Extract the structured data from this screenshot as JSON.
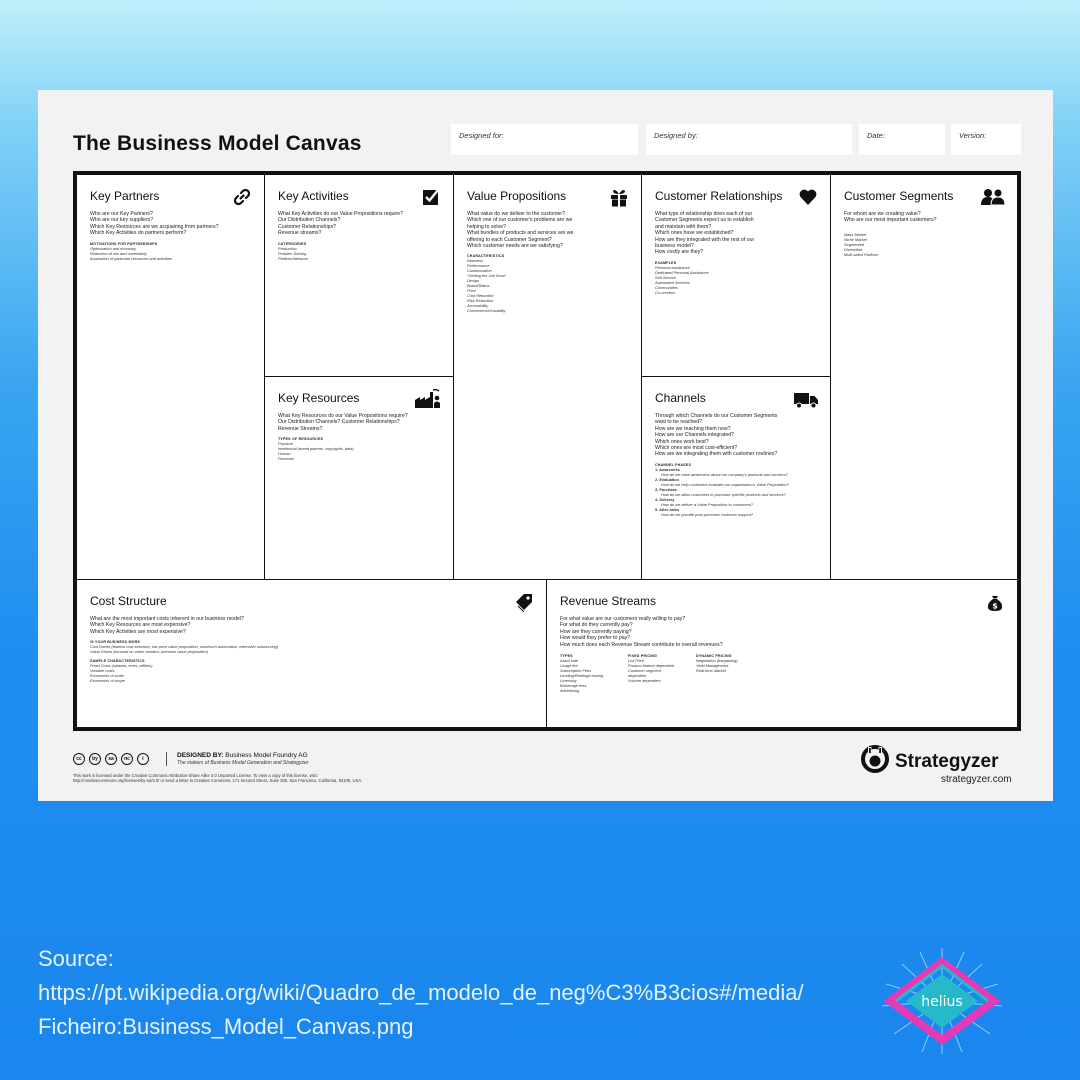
{
  "canvas": {
    "title": "The Business Model Canvas",
    "meta": {
      "designed_for": "Designed for:",
      "designed_by": "Designed by:",
      "date": "Date:",
      "version": "Version:"
    },
    "key_partners": {
      "title": "Key Partners",
      "icon": "link-icon",
      "questions": [
        "Who are our Key Partners?",
        "Who are our key suppliers?",
        "Which Key Resources are we acquairing from partners?",
        "Which Key Activities do partners perform?"
      ],
      "subhead": "MOTIVATIONS FOR PARTNERSHIPS",
      "examples": [
        "Optimization and economy",
        "Reduction of risk and uncertainty",
        "Acquisition of particular resources and activities"
      ]
    },
    "key_activities": {
      "title": "Key Activities",
      "icon": "checkbox-icon",
      "questions": [
        "What Key Activities do our Value Propositions require?",
        "Our Distribution Channels?",
        "Customer Relationships?",
        "Revenue streams?"
      ],
      "subhead": "CATERGORIES",
      "examples": [
        "Production",
        "Problem Solving",
        "Platform/Network"
      ]
    },
    "key_resources": {
      "title": "Key Resources",
      "icon": "factory-icon",
      "questions": [
        "What Key Resources do our Value Propositions require?",
        "Our Distribution Channels? Customer Relationships?",
        "Revenue Streams?"
      ],
      "subhead": "TYPES OF RESOURCES",
      "examples": [
        "Physical",
        "Intellectual (brand patents, copyrights, data)",
        "Human",
        "Financial"
      ]
    },
    "value_propositions": {
      "title": "Value Propositions",
      "icon": "gift-icon",
      "questions": [
        "What value do we deliver to the customer?",
        "Which one of our customer's problems are we",
        "helping to solve?",
        "What bundles of products and services are we",
        "offering to each Customer Segment?",
        "Which customer needs are we satisfying?"
      ],
      "subhead": "CHARACTERISTICS",
      "examples": [
        "Newness",
        "Performance",
        "Customization",
        "\"Getting the Job Done\"",
        "Design",
        "Brand/Status",
        "Price",
        "Cost Reduction",
        "Risk Reduction",
        "Accessibility",
        "Convenience/Usability"
      ]
    },
    "customer_relationships": {
      "title": "Customer Relationships",
      "icon": "heart-icon",
      "questions": [
        "What type of relationship does each of our",
        "Customer Segments expect us to establish",
        "and maintain with them?",
        "Which ones have we established?",
        "How are they integrated with the rest of our",
        "business model?",
        "How costly are they?"
      ],
      "subhead": "EXAMPLES",
      "examples": [
        "Personal assistance",
        "Dedicated Personal Assistance",
        "Self-Service",
        "Automated Services",
        "Communities",
        "Co-creation"
      ]
    },
    "channels": {
      "title": "Channels",
      "icon": "truck-icon",
      "questions": [
        "Through which Channels do our Customer Segments",
        "want to be reached?",
        "How are we reaching them now?",
        "How are our Channels integrated?",
        "Which ones work best?",
        "Which ones are most cost-efficient?",
        "How are we integrating them with customer routines?"
      ],
      "subhead": "CHANNEL PHASES",
      "phases": [
        {
          "name": "1. Awareness",
          "desc": "How do we raise awareness about our company's products and services?"
        },
        {
          "name": "2. Evaluation",
          "desc": "How do we help customers evaluate our organization's Value Proposition?"
        },
        {
          "name": "3. Purchase",
          "desc": "How do we allow customers to purchase specific products and services?"
        },
        {
          "name": "4. Delivery",
          "desc": "How do we deliver a Value Proposition to customers?"
        },
        {
          "name": "5. After sales",
          "desc": "How do we provide post-purchase customer support?"
        }
      ]
    },
    "customer_segments": {
      "title": "Customer Segments",
      "icon": "people-icon",
      "questions": [
        "For whom are we creating value?",
        "Who are our most important customers?"
      ],
      "examples": [
        "Mass Market",
        "Niche Market",
        "Segmented",
        "Diversified",
        "Multi-sided Platform"
      ]
    },
    "cost_structure": {
      "title": "Cost Structure",
      "icon": "tag-icon",
      "questions": [
        "What are the most important costs inherent in our business model?",
        "Which Key Resources are most expensive?",
        "Which Key Activities are most expensive?"
      ],
      "subhead_1": "IS YOUR BUSINESS MORE",
      "examples_1": [
        "Cost Driven (leanest cost structure, low price value proposition, maximum automation, extensive outsourcing)",
        "Value Driven (focused on value creation, premium value proposition)"
      ],
      "subhead_2": "SAMPLE CHARACTERISTICS",
      "examples_2": [
        "Fixed Costs (salaries, rents, utilities)",
        "Variable costs",
        "Economies of scale",
        "Economies of scope"
      ]
    },
    "revenue_streams": {
      "title": "Revenue Streams",
      "icon": "money-bag-icon",
      "questions": [
        "For what value are our customers really willing to pay?",
        "For what do they currently pay?",
        "How are they currently paying?",
        "How would they prefer to pay?",
        "How much does each Revenue Stream contribute to overall revenues?"
      ],
      "columns": [
        {
          "head": "TYPES",
          "items": [
            "Asset sale",
            "Usage fee",
            "Subscription Fees",
            "Lending/Renting/Leasing",
            "Licensing",
            "Brokerage fees",
            "Advertising"
          ]
        },
        {
          "head": "FIXED PRICING",
          "items": [
            "List Price",
            "Product feature dependent",
            "Customer segment",
            "dependent",
            "Volume dependent"
          ]
        },
        {
          "head": "DYNAMIC PRICING",
          "items": [
            "Negotiation (bargaining)",
            "Yield Management",
            "Real-time-Market"
          ]
        }
      ]
    },
    "footer": {
      "cc_icons": [
        "cc",
        "by",
        "sa",
        "nc",
        "i"
      ],
      "designed_by_label": "DESIGNED BY:",
      "designed_by_value": "Business Model Foundry AG",
      "designed_by_tagline": "The makers of Business Model Generation and Strategyzer",
      "license_line_1": "This work is licensed under the Creative Commons Attribution-Share Alike 3.0 Unported License. To view a copy of this license, visit:",
      "license_line_2": "http://creativecommons.org/licenses/by-sa/3.0/ or send a letter to Creative Commons, 171 Second Street, Suite 300, San Francisco, California, 94105, USA.",
      "brand_name": "Strategyzer",
      "brand_url": "strategyzer.com"
    }
  },
  "source": {
    "label": "Source:",
    "line_1": "https://pt.wikipedia.org/wiki/Quadro_de_modelo_de_neg%C3%B3cios#/media/",
    "line_2": "Ficheiro:Business_Model_Canvas.png"
  },
  "helius_logo": {
    "text": "helius",
    "colors": {
      "pink": "#e23bb5",
      "teal": "#27b8c9",
      "white": "#ffffff"
    }
  }
}
